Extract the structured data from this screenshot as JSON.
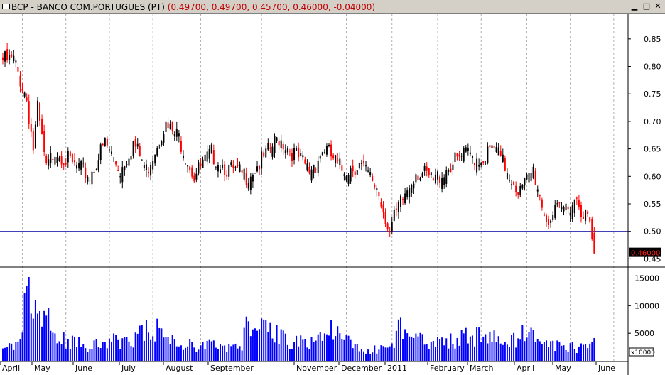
{
  "window": {
    "symbol_title": "BCP - BANCO COM.PORTUGUES (PT)",
    "values_text": "(0.49700, 0.49700, 0.45700, 0.46000, -0.04000)"
  },
  "chart_data": {
    "type": "candlestick",
    "ohlc_latest": {
      "open": 0.497,
      "high": 0.497,
      "low": 0.457,
      "close": 0.46,
      "change": -0.04
    },
    "price_axis": {
      "ylim": [
        0.435,
        0.895
      ],
      "ticks": [
        "0.85",
        "0.80",
        "0.75",
        "0.70",
        "0.65",
        "0.60",
        "0.55",
        "0.50",
        "0.45"
      ],
      "reference_line": 0.5,
      "last_price_label": "0.46000"
    },
    "volume_axis": {
      "ylim": [
        0,
        17000
      ],
      "ticks": [
        "15000",
        "10000",
        "5000"
      ],
      "multiplier_label": "x10000"
    },
    "x_axis": {
      "labels": [
        "April",
        "May",
        "June",
        "July",
        "August",
        "September",
        "November",
        "December",
        "2011",
        "February",
        "March",
        "April",
        "May",
        "June"
      ]
    },
    "price_series": {
      "name": "BCP",
      "keypoints": [
        [
          0,
          0.82
        ],
        [
          5,
          0.82
        ],
        [
          11,
          0.75
        ],
        [
          14,
          0.66
        ],
        [
          16,
          0.73
        ],
        [
          20,
          0.62
        ],
        [
          24,
          0.66
        ],
        [
          32,
          0.63
        ],
        [
          40,
          0.61
        ],
        [
          47,
          0.67
        ],
        [
          54,
          0.62
        ],
        [
          60,
          0.67
        ],
        [
          66,
          0.62
        ],
        [
          74,
          0.7
        ],
        [
          81,
          0.68
        ],
        [
          88,
          0.61
        ],
        [
          96,
          0.65
        ],
        [
          104,
          0.62
        ],
        [
          112,
          0.61
        ],
        [
          120,
          0.64
        ],
        [
          127,
          0.68
        ],
        [
          134,
          0.65
        ],
        [
          141,
          0.62
        ],
        [
          148,
          0.66
        ],
        [
          156,
          0.62
        ],
        [
          164,
          0.63
        ],
        [
          172,
          0.59
        ],
        [
          178,
          0.51
        ],
        [
          182,
          0.55
        ],
        [
          190,
          0.62
        ],
        [
          198,
          0.6
        ],
        [
          206,
          0.63
        ],
        [
          214,
          0.65
        ],
        [
          220,
          0.64
        ],
        [
          226,
          0.66
        ],
        [
          232,
          0.62
        ],
        [
          238,
          0.58
        ],
        [
          244,
          0.62
        ],
        [
          250,
          0.53
        ],
        [
          258,
          0.55
        ],
        [
          264,
          0.57
        ],
        [
          270,
          0.52
        ],
        [
          272,
          0.46
        ]
      ]
    },
    "volume_series": {
      "name": "Volume",
      "keypoints": [
        [
          0,
          2500
        ],
        [
          8,
          2700
        ],
        [
          12,
          15200
        ],
        [
          18,
          5000
        ],
        [
          20,
          8200
        ],
        [
          24,
          4000
        ],
        [
          40,
          2500
        ],
        [
          60,
          4200
        ],
        [
          70,
          5800
        ],
        [
          80,
          3000
        ],
        [
          110,
          2500
        ],
        [
          112,
          6200
        ],
        [
          140,
          3000
        ],
        [
          150,
          5500
        ],
        [
          165,
          1800
        ],
        [
          178,
          2200
        ],
        [
          182,
          6000
        ],
        [
          200,
          3200
        ],
        [
          220,
          4800
        ],
        [
          232,
          3000
        ],
        [
          240,
          4800
        ],
        [
          256,
          2600
        ],
        [
          266,
          2200
        ],
        [
          270,
          4500
        ],
        [
          272,
          4400
        ]
      ]
    },
    "colors": {
      "up": "#000000",
      "down": "#ff0000",
      "volume": "#0000ff",
      "reference_line": "#0000a0"
    }
  }
}
